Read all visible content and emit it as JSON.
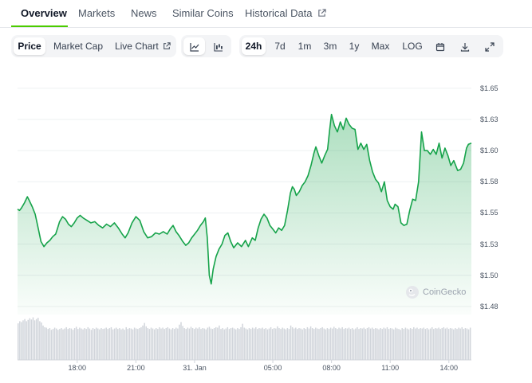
{
  "tabs": [
    {
      "label": "Overview",
      "active": true
    },
    {
      "label": "Markets"
    },
    {
      "label": "News"
    },
    {
      "label": "Similar Coins"
    },
    {
      "label": "Historical Data",
      "external": true
    }
  ],
  "toolbar": {
    "type_buttons": [
      {
        "label": "Price",
        "active": true
      },
      {
        "label": "Market Cap"
      },
      {
        "label": "Live Chart",
        "external": true
      }
    ],
    "view_icons": [
      "line-chart-icon",
      "candlestick-icon"
    ],
    "range_buttons": [
      {
        "label": "24h",
        "active": true
      },
      {
        "label": "7d"
      },
      {
        "label": "1m"
      },
      {
        "label": "3m"
      },
      {
        "label": "1y"
      },
      {
        "label": "Max"
      },
      {
        "label": "LOG"
      }
    ],
    "tool_icons": [
      "calendar-icon",
      "download-icon",
      "expand-icon"
    ]
  },
  "watermark": "CoinGecko",
  "colors": {
    "accent": "#4bcc00",
    "line": "#16a34a",
    "area": "#16a34a",
    "volume": "#d1d5db"
  },
  "chart_data": {
    "type": "area",
    "y_ticks": [
      "$1.65",
      "$1.63",
      "$1.60",
      "$1.58",
      "$1.55",
      "$1.53",
      "$1.50",
      "$1.48"
    ],
    "y_tick_values": [
      1.65,
      1.625,
      1.6,
      1.575,
      1.55,
      1.525,
      1.5,
      1.475
    ],
    "x_ticks": [
      {
        "label": "18:00",
        "t": 3
      },
      {
        "label": "21:00",
        "t": 6
      },
      {
        "label": "31. Jan",
        "t": 9
      },
      {
        "label": "05:00",
        "t": 13
      },
      {
        "label": "08:00",
        "t": 16
      },
      {
        "label": "11:00",
        "t": 19
      },
      {
        "label": "14:00",
        "t": 22
      }
    ],
    "x_range": [
      -0.05,
      23.15
    ],
    "y_range": [
      1.4685,
      1.6595
    ],
    "grid": true,
    "series": [
      {
        "points": [
          [
            -0.05,
            1.553
          ],
          [
            0.05,
            1.552
          ],
          [
            0.15,
            1.554
          ],
          [
            0.3,
            1.558
          ],
          [
            0.45,
            1.563
          ],
          [
            0.55,
            1.56
          ],
          [
            0.7,
            1.555
          ],
          [
            0.85,
            1.549
          ],
          [
            1.0,
            1.538
          ],
          [
            1.15,
            1.527
          ],
          [
            1.3,
            1.523
          ],
          [
            1.45,
            1.526
          ],
          [
            1.6,
            1.528
          ],
          [
            1.75,
            1.531
          ],
          [
            1.9,
            1.533
          ],
          [
            2.0,
            1.538
          ],
          [
            2.1,
            1.543
          ],
          [
            2.25,
            1.547
          ],
          [
            2.4,
            1.545
          ],
          [
            2.55,
            1.541
          ],
          [
            2.7,
            1.539
          ],
          [
            2.85,
            1.542
          ],
          [
            3.0,
            1.546
          ],
          [
            3.15,
            1.548
          ],
          [
            3.3,
            1.546
          ],
          [
            3.5,
            1.544
          ],
          [
            3.7,
            1.542
          ],
          [
            3.9,
            1.543
          ],
          [
            4.1,
            1.54
          ],
          [
            4.3,
            1.538
          ],
          [
            4.5,
            1.541
          ],
          [
            4.7,
            1.539
          ],
          [
            4.9,
            1.542
          ],
          [
            5.1,
            1.538
          ],
          [
            5.3,
            1.533
          ],
          [
            5.45,
            1.53
          ],
          [
            5.6,
            1.534
          ],
          [
            5.8,
            1.542
          ],
          [
            6.0,
            1.547
          ],
          [
            6.2,
            1.544
          ],
          [
            6.4,
            1.535
          ],
          [
            6.6,
            1.53
          ],
          [
            6.8,
            1.531
          ],
          [
            7.0,
            1.534
          ],
          [
            7.2,
            1.533
          ],
          [
            7.4,
            1.535
          ],
          [
            7.6,
            1.533
          ],
          [
            7.75,
            1.537
          ],
          [
            7.9,
            1.54
          ],
          [
            8.05,
            1.535
          ],
          [
            8.2,
            1.532
          ],
          [
            8.4,
            1.527
          ],
          [
            8.55,
            1.524
          ],
          [
            8.7,
            1.526
          ],
          [
            8.85,
            1.53
          ],
          [
            9.0,
            1.533
          ],
          [
            9.15,
            1.536
          ],
          [
            9.3,
            1.54
          ],
          [
            9.45,
            1.543
          ],
          [
            9.55,
            1.546
          ],
          [
            9.65,
            1.53
          ],
          [
            9.75,
            1.5
          ],
          [
            9.85,
            1.493
          ],
          [
            9.95,
            1.505
          ],
          [
            10.1,
            1.515
          ],
          [
            10.25,
            1.521
          ],
          [
            10.4,
            1.525
          ],
          [
            10.55,
            1.532
          ],
          [
            10.7,
            1.534
          ],
          [
            10.85,
            1.527
          ],
          [
            11.0,
            1.522
          ],
          [
            11.2,
            1.526
          ],
          [
            11.4,
            1.523
          ],
          [
            11.6,
            1.528
          ],
          [
            11.75,
            1.523
          ],
          [
            11.95,
            1.53
          ],
          [
            12.1,
            1.528
          ],
          [
            12.25,
            1.538
          ],
          [
            12.4,
            1.545
          ],
          [
            12.55,
            1.549
          ],
          [
            12.7,
            1.546
          ],
          [
            12.85,
            1.54
          ],
          [
            13.0,
            1.537
          ],
          [
            13.15,
            1.534
          ],
          [
            13.3,
            1.538
          ],
          [
            13.45,
            1.536
          ],
          [
            13.6,
            1.54
          ],
          [
            13.75,
            1.552
          ],
          [
            13.9,
            1.566
          ],
          [
            14.0,
            1.571
          ],
          [
            14.1,
            1.569
          ],
          [
            14.2,
            1.564
          ],
          [
            14.35,
            1.567
          ],
          [
            14.5,
            1.572
          ],
          [
            14.65,
            1.575
          ],
          [
            14.8,
            1.58
          ],
          [
            14.95,
            1.588
          ],
          [
            15.1,
            1.598
          ],
          [
            15.2,
            1.603
          ],
          [
            15.35,
            1.596
          ],
          [
            15.5,
            1.59
          ],
          [
            15.65,
            1.596
          ],
          [
            15.8,
            1.601
          ],
          [
            15.9,
            1.616
          ],
          [
            16.0,
            1.629
          ],
          [
            16.15,
            1.62
          ],
          [
            16.3,
            1.615
          ],
          [
            16.45,
            1.623
          ],
          [
            16.6,
            1.617
          ],
          [
            16.75,
            1.626
          ],
          [
            16.9,
            1.621
          ],
          [
            17.05,
            1.618
          ],
          [
            17.2,
            1.617
          ],
          [
            17.35,
            1.601
          ],
          [
            17.5,
            1.606
          ],
          [
            17.65,
            1.601
          ],
          [
            17.8,
            1.605
          ],
          [
            17.95,
            1.592
          ],
          [
            18.1,
            1.583
          ],
          [
            18.25,
            1.577
          ],
          [
            18.4,
            1.574
          ],
          [
            18.55,
            1.567
          ],
          [
            18.7,
            1.575
          ],
          [
            18.85,
            1.56
          ],
          [
            19.0,
            1.555
          ],
          [
            19.15,
            1.553
          ],
          [
            19.25,
            1.557
          ],
          [
            19.4,
            1.555
          ],
          [
            19.55,
            1.542
          ],
          [
            19.7,
            1.54
          ],
          [
            19.85,
            1.541
          ],
          [
            20.0,
            1.552
          ],
          [
            20.15,
            1.561
          ],
          [
            20.3,
            1.56
          ],
          [
            20.45,
            1.575
          ],
          [
            20.6,
            1.615
          ],
          [
            20.75,
            1.6
          ],
          [
            20.9,
            1.6
          ],
          [
            21.05,
            1.597
          ],
          [
            21.2,
            1.601
          ],
          [
            21.35,
            1.597
          ],
          [
            21.5,
            1.606
          ],
          [
            21.65,
            1.594
          ],
          [
            21.8,
            1.602
          ],
          [
            21.95,
            1.596
          ],
          [
            22.1,
            1.588
          ],
          [
            22.25,
            1.592
          ],
          [
            22.45,
            1.584
          ],
          [
            22.6,
            1.585
          ],
          [
            22.75,
            1.59
          ],
          [
            22.9,
            1.602
          ],
          [
            23.0,
            1.605
          ],
          [
            23.15,
            1.606
          ]
        ]
      }
    ],
    "volume": {
      "values": [
        0.85,
        0.9,
        0.88,
        0.92,
        0.95,
        0.9,
        0.93,
        0.97,
        0.94,
        0.99,
        0.92,
        0.95,
        0.98,
        0.9,
        0.87,
        0.8,
        0.76,
        0.75,
        0.72,
        0.74,
        0.7,
        0.72,
        0.75,
        0.73,
        0.7,
        0.72,
        0.74,
        0.71,
        0.73,
        0.76,
        0.72,
        0.74,
        0.73,
        0.7,
        0.74,
        0.77,
        0.72,
        0.75,
        0.73,
        0.71,
        0.74,
        0.72,
        0.76,
        0.73,
        0.7,
        0.74,
        0.72,
        0.75,
        0.73,
        0.71,
        0.74,
        0.72,
        0.73,
        0.75,
        0.72,
        0.74,
        0.76,
        0.71,
        0.73,
        0.75,
        0.72,
        0.74,
        0.71,
        0.73,
        0.7,
        0.76,
        0.72,
        0.74,
        0.73,
        0.71,
        0.75,
        0.73,
        0.72,
        0.74,
        0.76,
        0.8,
        0.86,
        0.78,
        0.74,
        0.72,
        0.75,
        0.73,
        0.71,
        0.74,
        0.72,
        0.76,
        0.73,
        0.75,
        0.72,
        0.74,
        0.76,
        0.73,
        0.71,
        0.74,
        0.72,
        0.75,
        0.73,
        0.82,
        0.88,
        0.79,
        0.74,
        0.72,
        0.75,
        0.73,
        0.77,
        0.74,
        0.72,
        0.75,
        0.73,
        0.76,
        0.72,
        0.74,
        0.73,
        0.71,
        0.75,
        0.77,
        0.73,
        0.72,
        0.74,
        0.76,
        0.75,
        0.8,
        0.72,
        0.74,
        0.71,
        0.73,
        0.76,
        0.72,
        0.74,
        0.75,
        0.73,
        0.71,
        0.74,
        0.72,
        0.76,
        0.84,
        0.75,
        0.73,
        0.71,
        0.74,
        0.72,
        0.75,
        0.73,
        0.76,
        0.72,
        0.74,
        0.73,
        0.75,
        0.72,
        0.74,
        0.71,
        0.73,
        0.76,
        0.72,
        0.74,
        0.73,
        0.78,
        0.74,
        0.72,
        0.75,
        0.73,
        0.71,
        0.74,
        0.72,
        0.8,
        0.76,
        0.73,
        0.75,
        0.72,
        0.74,
        0.73,
        0.71,
        0.74,
        0.72,
        0.76,
        0.73,
        0.78,
        0.74,
        0.72,
        0.75,
        0.73,
        0.72,
        0.74,
        0.76,
        0.73,
        0.71,
        0.74,
        0.72,
        0.75,
        0.73,
        0.77,
        0.74,
        0.72,
        0.75,
        0.73,
        0.76,
        0.72,
        0.74,
        0.73,
        0.75,
        0.72,
        0.74,
        0.71,
        0.73,
        0.76,
        0.72,
        0.74,
        0.73,
        0.75,
        0.72,
        0.74,
        0.76,
        0.73,
        0.75,
        0.72,
        0.74,
        0.73,
        0.71,
        0.74,
        0.72,
        0.75,
        0.73,
        0.76,
        0.72,
        0.74,
        0.73,
        0.71,
        0.75,
        0.73,
        0.72,
        0.7,
        0.74,
        0.72,
        0.75,
        0.73,
        0.71,
        0.74,
        0.72,
        0.76,
        0.73,
        0.75,
        0.72,
        0.74,
        0.73,
        0.75,
        0.72,
        0.74,
        0.71,
        0.73,
        0.76,
        0.72,
        0.74,
        0.73,
        0.75,
        0.72,
        0.74,
        0.76,
        0.73,
        0.75,
        0.72,
        0.74,
        0.73,
        0.71,
        0.74,
        0.72,
        0.75,
        0.73,
        0.76,
        0.72,
        0.74,
        0.73,
        0.71,
        0.75
      ]
    }
  }
}
